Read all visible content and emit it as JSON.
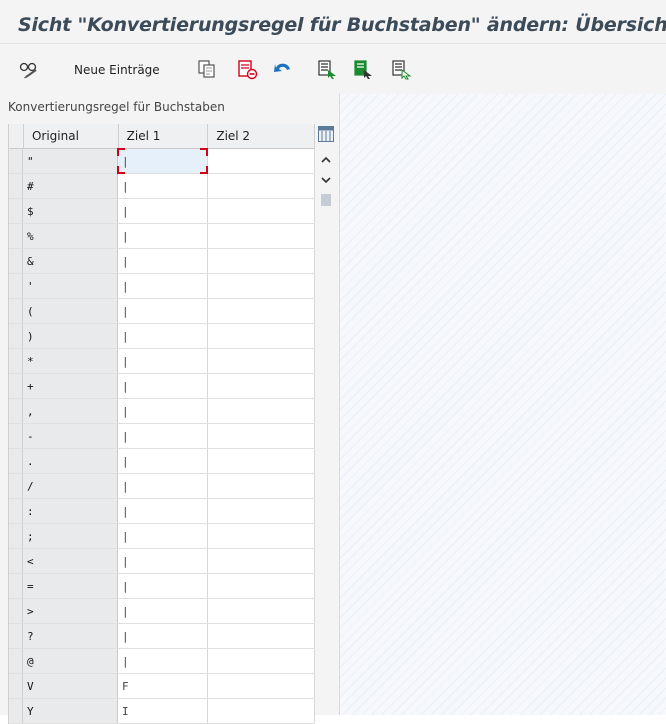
{
  "window": {
    "title": "Sicht \"Konvertierungsregel für Buchstaben\" ändern: Übersicht"
  },
  "toolbar": {
    "new_entries_label": "Neue Einträge",
    "icons": [
      "glasses-pen-icon",
      "copy-icon",
      "delete-icon",
      "undo-icon",
      "select-all-icon",
      "select-block-icon",
      "deselect-all-icon"
    ]
  },
  "table": {
    "title": "Konvertierungsregel für Buchstaben",
    "columns": {
      "original": "Original",
      "ziel1": "Ziel 1",
      "ziel2": "Ziel 2"
    },
    "rows": [
      {
        "original": "\"",
        "ziel1": "|",
        "ziel2": ""
      },
      {
        "original": "#",
        "ziel1": "|",
        "ziel2": ""
      },
      {
        "original": "$",
        "ziel1": "|",
        "ziel2": ""
      },
      {
        "original": "%",
        "ziel1": "|",
        "ziel2": ""
      },
      {
        "original": "&",
        "ziel1": "|",
        "ziel2": ""
      },
      {
        "original": "'",
        "ziel1": "|",
        "ziel2": ""
      },
      {
        "original": "(",
        "ziel1": "|",
        "ziel2": ""
      },
      {
        "original": ")",
        "ziel1": "|",
        "ziel2": ""
      },
      {
        "original": "*",
        "ziel1": "|",
        "ziel2": ""
      },
      {
        "original": "+",
        "ziel1": "|",
        "ziel2": ""
      },
      {
        "original": ",",
        "ziel1": "|",
        "ziel2": ""
      },
      {
        "original": "-",
        "ziel1": "|",
        "ziel2": ""
      },
      {
        "original": ".",
        "ziel1": "|",
        "ziel2": ""
      },
      {
        "original": "/",
        "ziel1": "|",
        "ziel2": ""
      },
      {
        "original": ":",
        "ziel1": "|",
        "ziel2": ""
      },
      {
        "original": ";",
        "ziel1": "|",
        "ziel2": ""
      },
      {
        "original": "<",
        "ziel1": "|",
        "ziel2": ""
      },
      {
        "original": "=",
        "ziel1": "|",
        "ziel2": ""
      },
      {
        "original": ">",
        "ziel1": "|",
        "ziel2": ""
      },
      {
        "original": "?",
        "ziel1": "|",
        "ziel2": ""
      },
      {
        "original": "@",
        "ziel1": "|",
        "ziel2": ""
      },
      {
        "original": "V",
        "ziel1": "F",
        "ziel2": ""
      },
      {
        "original": "Y",
        "ziel1": "I",
        "ziel2": ""
      }
    ]
  },
  "colors": {
    "accent_green": "#1a8a2e",
    "accent_red": "#d0021b",
    "accent_blue": "#1e73be",
    "title_text": "#3b4b5a"
  }
}
